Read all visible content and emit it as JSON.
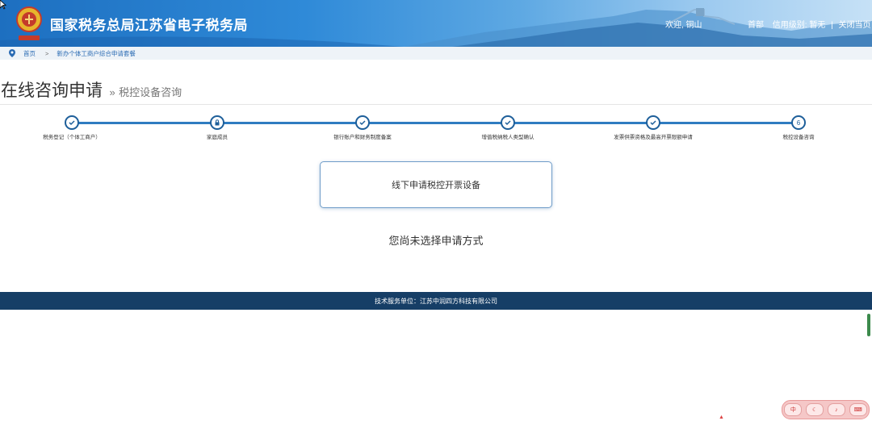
{
  "header": {
    "site_title": "国家税务总局江苏省电子税务局",
    "welcome": "欢迎, 铜山",
    "nav": [
      {
        "label": "首部"
      },
      {
        "label": "信用级别: 暂无"
      },
      {
        "label": "关闭当页"
      }
    ],
    "logo_icon": "tax-emblem-icon"
  },
  "breadcrumb": {
    "home": "首页",
    "arrow": ">",
    "current": "新办个体工商户综合申请套餐",
    "icon": "location-pin-icon"
  },
  "page": {
    "title": "在线咨询申请",
    "separator": "»",
    "subtitle": "税控设备咨询"
  },
  "steps": [
    {
      "label": "税务登记（个体工商户）",
      "state": "done",
      "icon": "check-icon"
    },
    {
      "label": "家庭成员",
      "state": "locked",
      "icon": "lock-icon"
    },
    {
      "label": "银行账户和财务制度备案",
      "state": "done",
      "icon": "check-icon"
    },
    {
      "label": "增值税纳税人类型确认",
      "state": "done",
      "icon": "check-icon"
    },
    {
      "label": "发票供票资格及最高开票限额申请",
      "state": "done",
      "icon": "check-icon"
    },
    {
      "label": "税控设备咨询",
      "state": "current",
      "number": "6"
    }
  ],
  "content": {
    "apply_option": "线下申请税控开票设备",
    "status_message": "您尚未选择申请方式"
  },
  "footer": {
    "text": "技术服务单位：江苏中润四方科技有限公司"
  },
  "colors": {
    "accent": "#2f7cc0",
    "footer_bg": "#163e66",
    "step_border": "#1e5f9a"
  }
}
